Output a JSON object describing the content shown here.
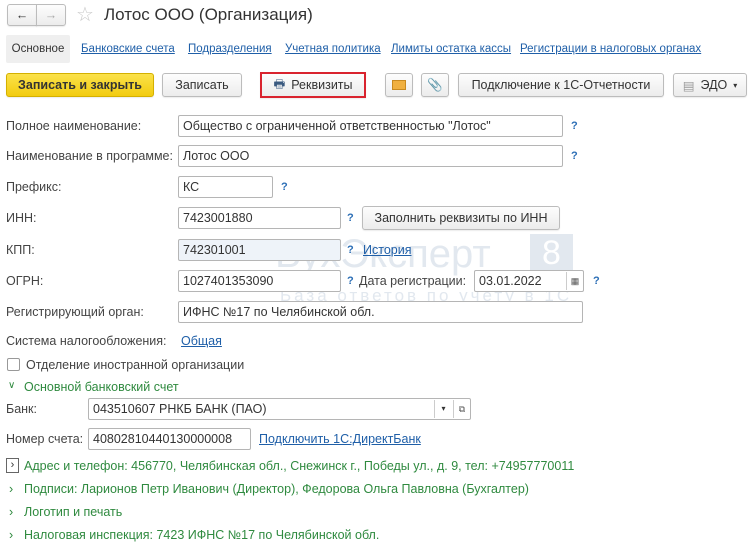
{
  "window": {
    "title": "Лотос ООО (Организация)"
  },
  "tabs": [
    {
      "label": "Основное",
      "active": true
    },
    {
      "label": "Банковские счета"
    },
    {
      "label": "Подразделения"
    },
    {
      "label": "Учетная политика"
    },
    {
      "label": "Лимиты остатка кассы"
    },
    {
      "label": "Регистрации в налоговых органах"
    }
  ],
  "toolbar": {
    "save_close": "Записать и закрыть",
    "save": "Записать",
    "requisites": "Реквизиты",
    "reporting": "Подключение к 1С-Отчетности",
    "edo": "ЭДО"
  },
  "form": {
    "full_name": {
      "label": "Полное наименование:",
      "value": "Общество с ограниченной ответственностью \"Лотос\""
    },
    "program_name": {
      "label": "Наименование в программе:",
      "value": "Лотос ООО"
    },
    "prefix": {
      "label": "Префикс:",
      "value": "КС"
    },
    "inn": {
      "label": "ИНН:",
      "value": "7423001880",
      "fill_button": "Заполнить реквизиты по ИНН"
    },
    "kpp": {
      "label": "КПП:",
      "value": "742301001",
      "history_link": "История"
    },
    "ogrn": {
      "label": "ОГРН:",
      "value": "1027401353090"
    },
    "reg_date": {
      "label": "Дата регистрации:",
      "value": "03.01.2022"
    },
    "reg_authority": {
      "label": "Регистрирующий орган:",
      "value": "ИФНС №17 по Челябинской обл."
    },
    "tax_system": {
      "label": "Система налогообложения:",
      "value": "Общая"
    },
    "foreign_branch": {
      "label": "Отделение иностранной организации",
      "checked": false
    },
    "help": "?"
  },
  "bank_section": {
    "title": "Основной банковский счет",
    "bank_label": "Банк:",
    "bank_value": "043510607 РНКБ БАНК (ПАО)",
    "account_label": "Номер счета:",
    "account_value": "40802810440130000008",
    "directbank_link": "Подключить 1С:ДиректБанк"
  },
  "groups": [
    {
      "label": "Адрес и телефон: 456770, Челябинская обл., Снежинск г., Победы ул., д. 9, тел: +74957770011"
    },
    {
      "label": "Подписи: Ларионов Петр Иванович (Директор), Федорова Ольга Павловна (Бухгалтер)"
    },
    {
      "label": "Логотип и печать"
    },
    {
      "label": "Налоговая инспекция: 7423 ИФНС №17 по Челябинской обл."
    }
  ],
  "watermark": {
    "brand": "БухЭксперт",
    "digit": "8",
    "tagline": "База ответов по учету в 1С"
  },
  "colors": {
    "accent_yellow": "#f7d51d",
    "link": "#1f5fa8",
    "group_green": "#2f8a3f",
    "highlight": "#d9232e"
  }
}
